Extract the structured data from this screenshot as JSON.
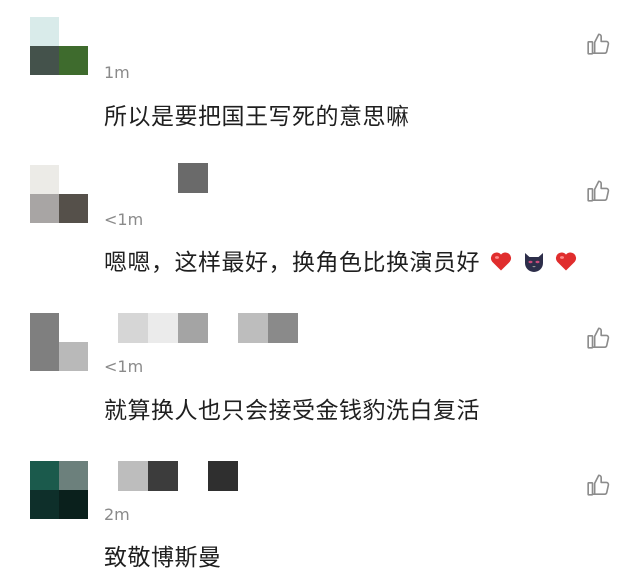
{
  "comments": [
    {
      "time": "1m",
      "text": "所以是要把国王写死的意思嘛",
      "avatar_tiles": [
        "#d9ebea",
        "#ffffff",
        "#44524b",
        "#3e6b2d"
      ],
      "like_icon": "thumbs-up-icon"
    },
    {
      "time": "<1m",
      "text": "嗯嗯，这样最好，换角色比换演员好",
      "emojis": [
        "red-heart",
        "black-cat-face",
        "red-heart"
      ],
      "avatar_tiles": [
        "#ecebe7",
        "#ffffff",
        "#a8a5a4",
        "#55504a"
      ],
      "like_icon": "thumbs-up-icon"
    },
    {
      "time": "<1m",
      "text": "就算换人也只会接受金钱豹洗白复活",
      "avatar_tiles": [
        "#7f7f7f",
        "#ffffff",
        "#7f7f7f",
        "#b9b9b9"
      ],
      "like_icon": "thumbs-up-icon"
    },
    {
      "time": "2m",
      "text": "致敬博斯曼",
      "avatar_tiles": [
        "#1b5a4c",
        "#6c807c",
        "#0e2f2a",
        "#0a201c"
      ],
      "like_icon": "thumbs-up-icon"
    }
  ]
}
